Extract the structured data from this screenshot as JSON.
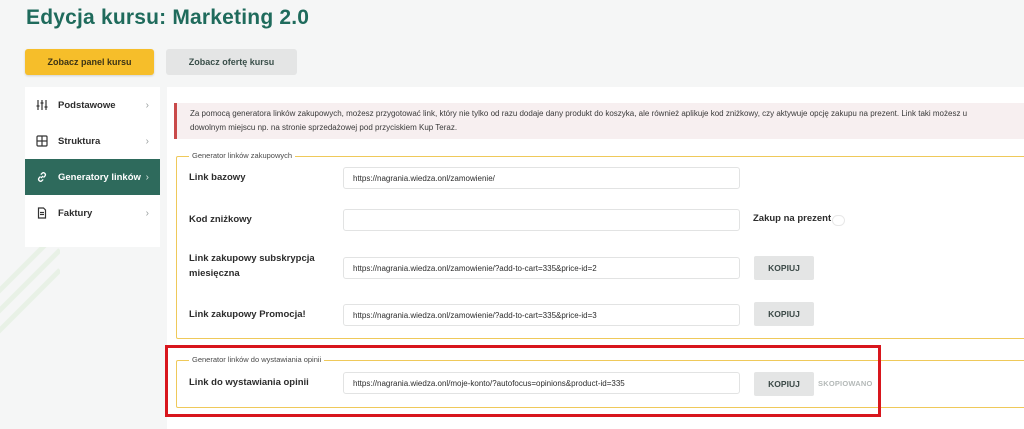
{
  "page": {
    "title": "Edycja kursu: Marketing 2.0"
  },
  "top_buttons": {
    "panel_label": "Zobacz panel kursu",
    "offer_label": "Zobacz ofertę kursu"
  },
  "sidebar": {
    "items": [
      {
        "label": "Podstawowe",
        "icon": "sliders-icon",
        "active": false
      },
      {
        "label": "Struktura",
        "icon": "grid-icon",
        "active": false
      },
      {
        "label": "Generatory linków",
        "icon": "link-icon",
        "active": true
      },
      {
        "label": "Faktury",
        "icon": "document-icon",
        "active": false
      }
    ]
  },
  "info": {
    "line1": "Za pomocą generatora linków zakupowych, możesz przygotować link, który nie tylko od razu dodaje dany produkt do koszyka, ale również aplikuje kod zniżkowy, czy aktywuje opcję zakupu na prezent. Link taki możesz u",
    "line2": "dowolnym miejscu np. na stronie sprzedażowej pod przyciskiem Kup Teraz."
  },
  "purchase_generator": {
    "legend": "Generator linków zakupowych",
    "base_link": {
      "label": "Link bazowy",
      "value": "https://nagrania.wiedza.onl/zamowienie/"
    },
    "discount_code": {
      "label": "Kod zniżkowy",
      "value": "",
      "placeholder": ""
    },
    "gift": {
      "label": "Zakup na prezent",
      "enabled": false
    },
    "subscription_link": {
      "label_line1": "Link zakupowy subskrypcja",
      "label_line2": "miesięczna",
      "value": "https://nagrania.wiedza.onl/zamowienie/?add-to-cart=335&price-id=2",
      "button": "KOPIUJ"
    },
    "promo_link": {
      "label": "Link zakupowy Promocja!",
      "value": "https://nagrania.wiedza.onl/zamowienie/?add-to-cart=335&price-id=3",
      "button": "KOPIUJ"
    }
  },
  "review_generator": {
    "legend": "Generator linków do wystawiania opinii",
    "review_link": {
      "label": "Link do wystawiania opinii",
      "value": "https://nagrania.wiedza.onl/moje-konto/?autofocus=opinions&product-id=335",
      "button": "KOPIUJ",
      "status": "SKOPIOWANO"
    }
  },
  "colors": {
    "brand_green": "#2e6a5c",
    "title_green": "#1f6b5c",
    "accent_yellow": "#f6be2a",
    "info_border": "#c94a4a",
    "highlight_red": "#d8161d"
  }
}
